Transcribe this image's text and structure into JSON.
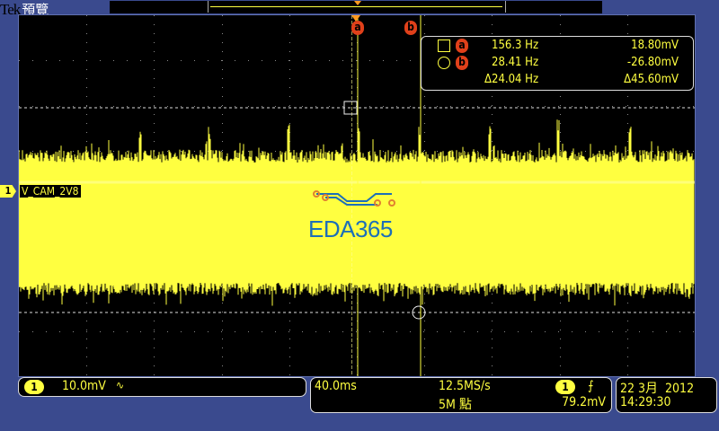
{
  "header": {
    "brand": "Tek",
    "mode": "預覽"
  },
  "cursors": {
    "a_label": "a",
    "b_label": "b"
  },
  "readout": {
    "row_a": {
      "shape_icon": "square-icon",
      "label": "a",
      "freq": "156.3 Hz",
      "volt": "18.80mV"
    },
    "row_b": {
      "shape_icon": "circle-icon",
      "label": "b",
      "freq": "28.41 Hz",
      "volt": "-26.80mV"
    },
    "delta": {
      "freq": "Δ24.04 Hz",
      "volt": "Δ45.60mV"
    }
  },
  "channel": {
    "number": "1",
    "name": "V_CAM_2V8",
    "scale": "10.0mV",
    "coupling_icon": "ac-coupling-icon",
    "coupling_glyph": "∿",
    "color": "#ffff40"
  },
  "watermark": {
    "text": "EDA365"
  },
  "timebase": {
    "time_per_div": "40.0ms",
    "sample_rate": "12.5MS/s",
    "record_length": "5M 點",
    "trigger_channel": "1",
    "trigger_slope_glyph": "⨍",
    "trigger_level": "79.2mV"
  },
  "datetime": {
    "date": "22 3月  2012",
    "time": "14:29:30"
  },
  "colors": {
    "trace": "#ffff40",
    "cursor": "#e0401a",
    "background": "#3a4a8e"
  }
}
